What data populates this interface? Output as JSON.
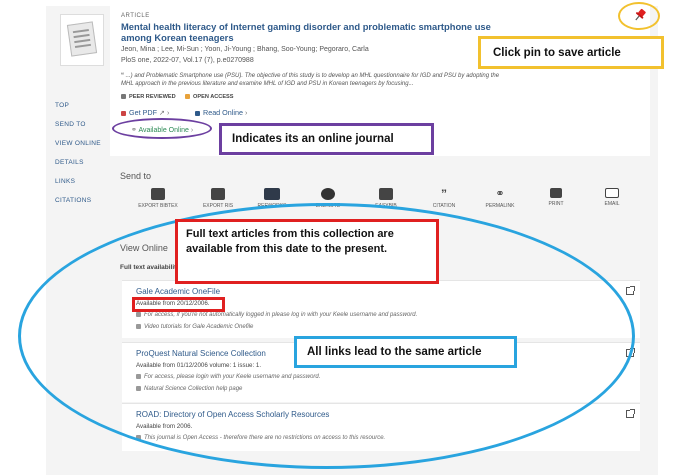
{
  "article": {
    "type_label": "ARTICLE",
    "title": "Mental health literacy of Internet gaming disorder and problematic smartphone use among Korean teenagers",
    "authors": "Jeon, Mina ; Lee, Mi-Sun ; Yoon, Ji-Young ; Bhang, Soo-Young; Pegoraro, Carla",
    "source": "PloS one, 2022-07, Vol.17 (7), p.e0270988",
    "snippet": "...) and Problematic Smartphone use (PSU). The objective of this study is to develop an MHL questionnaire for IGD and PSU by adopting the MHL approach in the previous literature and examine MHL of IGD and PSU in Korean teenagers by focusing...",
    "peer_reviewed": "PEER REVIEWED",
    "open_access": "OPEN ACCESS",
    "get_pdf": "Get PDF",
    "read_online": "Read Online",
    "available_online": "Available Online"
  },
  "left_nav": [
    "TOP",
    "SEND TO",
    "VIEW ONLINE",
    "DETAILS",
    "LINKS",
    "CITATIONS"
  ],
  "send_to": {
    "heading": "Send to",
    "items": [
      "EXPORT BIBTEX",
      "EXPORT RIS",
      "REFWORKS",
      "ENDNOTE",
      "EASYBIB",
      "CITATION",
      "PERMALINK",
      "PRINT",
      "EMAIL"
    ]
  },
  "view_online": {
    "heading": "View Online",
    "fulltext_header": "Full text availability",
    "providers": [
      {
        "name": "Gale Academic OneFile",
        "availability": "Available from 20/12/2006.",
        "note": "For access, if you're not automatically logged in please log in with your Keele username and password.",
        "help": "Video tutorials for Gale Academic Onefile"
      },
      {
        "name": "ProQuest Natural Science Collection",
        "availability": "Available from 01/12/2006 volume: 1 issue: 1.",
        "note": "For access, please login with your Keele username and password.",
        "help": "Natural Science Collection help page"
      },
      {
        "name": "ROAD: Directory of Open Access Scholarly Resources",
        "availability": "Available from 2006.",
        "note": "This journal is Open Access - therefore there are no restrictions on access to this resource.",
        "help": ""
      }
    ]
  },
  "callouts": {
    "pin": "Click pin to save article",
    "online_journal": "Indicates its an online journal",
    "fulltext": "Full text articles from this collection are available from this date to the present.",
    "links": "All links lead to the same article"
  },
  "colors": {
    "pin": "#e02020",
    "yellow": "#f2c12e",
    "purple": "#6c3fa0",
    "red": "#e02020",
    "blue": "#29a4df",
    "link": "#2f5a8a",
    "green": "#2e8b57"
  }
}
